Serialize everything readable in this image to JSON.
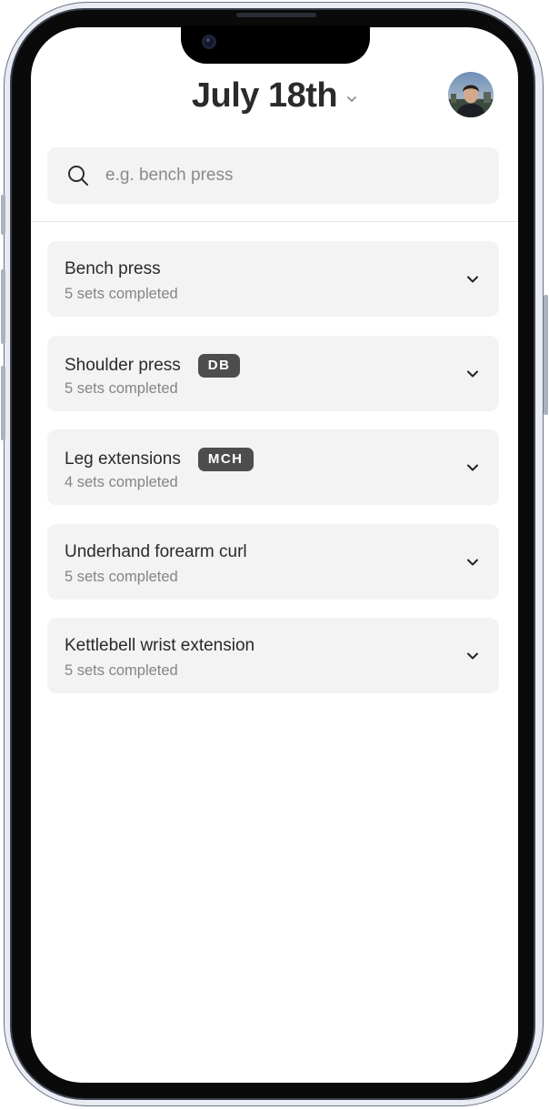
{
  "header": {
    "date_label": "July 18th",
    "date_dropdown_icon": "chevron-down-icon",
    "avatar_icon": "profile-avatar"
  },
  "search": {
    "icon": "search-icon",
    "placeholder": "e.g. bench press",
    "value": ""
  },
  "exercises": [
    {
      "name": "Bench press",
      "badge": "",
      "status": "5 sets completed"
    },
    {
      "name": "Shoulder press",
      "badge": "DB",
      "status": "5 sets completed"
    },
    {
      "name": "Leg extensions",
      "badge": "MCH",
      "status": "4 sets completed"
    },
    {
      "name": "Underhand forearm curl",
      "badge": "",
      "status": "5 sets completed"
    },
    {
      "name": "Kettlebell wrist extension",
      "badge": "",
      "status": "5 sets completed"
    }
  ],
  "colors": {
    "card_bg": "#f3f3f3",
    "badge_bg": "#4d4d4d",
    "text_primary": "#2a2a2a",
    "text_secondary": "#858585"
  }
}
